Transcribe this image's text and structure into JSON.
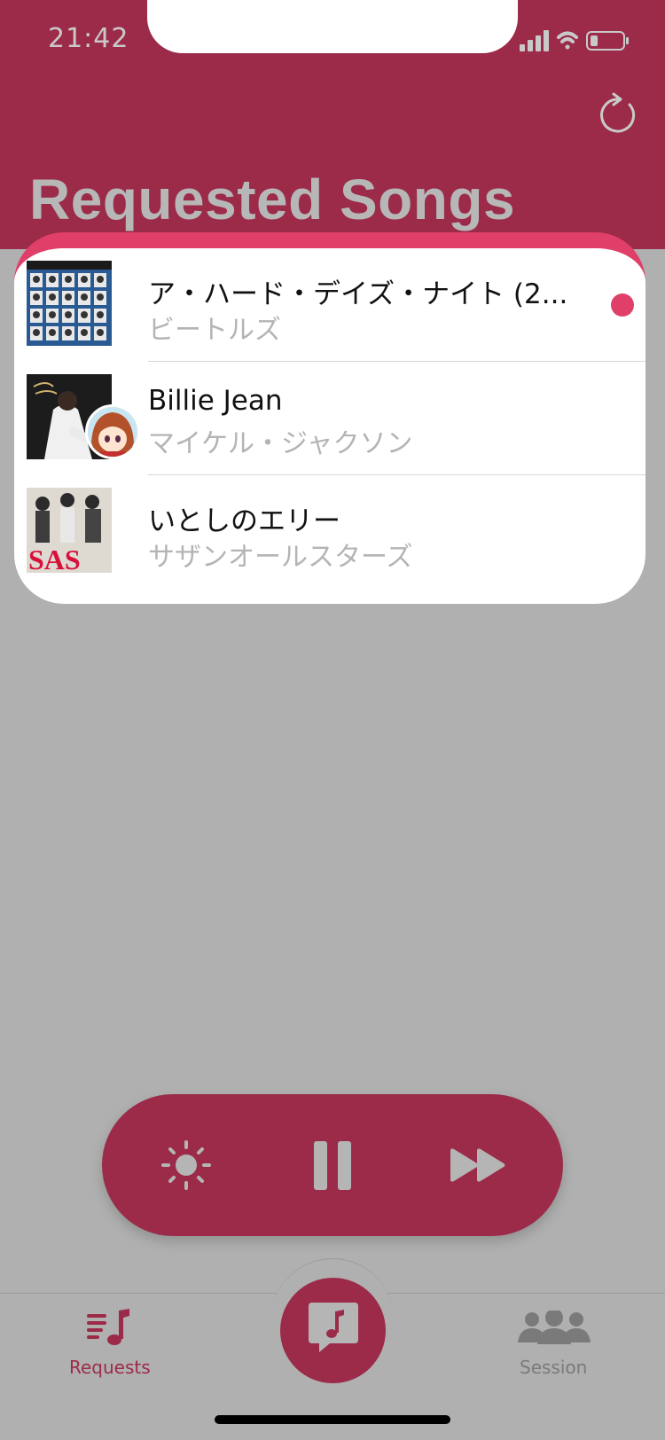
{
  "status_bar": {
    "time": "21:42"
  },
  "header": {
    "title": "Requested Songs",
    "refresh_icon": "refresh-icon"
  },
  "songs": [
    {
      "title": "ア・ハード・デイズ・ナイト (2...",
      "artist": "ビートルズ",
      "now_playing": true
    },
    {
      "title": "Billie Jean",
      "artist": "マイケル・ジャクソン",
      "now_playing": false
    },
    {
      "title": "いとしのエリー",
      "artist": "サザンオールスターズ",
      "now_playing": false
    }
  ],
  "album_art": {
    "sas_text": "SAS"
  },
  "player": {
    "brightness_icon": "sun-icon",
    "pause_icon": "pause-icon",
    "skip_icon": "fast-forward-icon"
  },
  "tabs": [
    {
      "label": "Requests",
      "icon": "music-list-icon",
      "active": true
    },
    {
      "label": "Session",
      "icon": "people-icon",
      "active": false
    }
  ],
  "colors": {
    "header": "#9b2b49",
    "accent": "#df3f68",
    "background": "#b0b0b0",
    "active_tab": "#9b2b49",
    "inactive_tab": "#7a7a7a"
  }
}
